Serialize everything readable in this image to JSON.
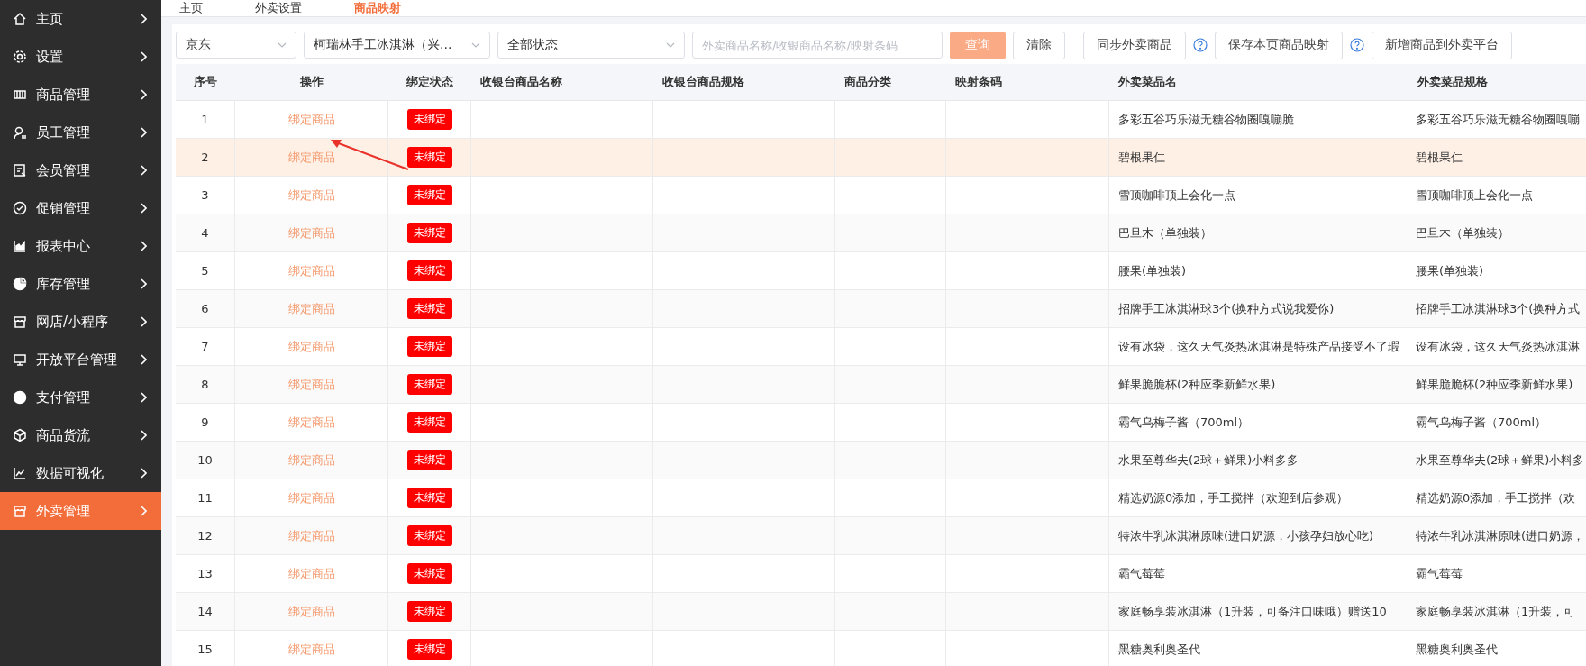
{
  "sidebar": {
    "items": [
      {
        "label": "主页",
        "selected": false
      },
      {
        "label": "设置",
        "selected": false
      },
      {
        "label": "商品管理",
        "selected": false
      },
      {
        "label": "员工管理",
        "selected": false
      },
      {
        "label": "会员管理",
        "selected": false
      },
      {
        "label": "促销管理",
        "selected": false
      },
      {
        "label": "报表中心",
        "selected": false
      },
      {
        "label": "库存管理",
        "selected": false
      },
      {
        "label": "网店/小程序",
        "selected": false
      },
      {
        "label": "开放平台管理",
        "selected": false
      },
      {
        "label": "支付管理",
        "selected": false
      },
      {
        "label": "商品货流",
        "selected": false
      },
      {
        "label": "数据可视化",
        "selected": false
      },
      {
        "label": "外卖管理",
        "selected": true
      }
    ]
  },
  "tabs": [
    {
      "label": "主页",
      "selected": false
    },
    {
      "label": "外卖设置",
      "selected": false
    },
    {
      "label": "商品映射",
      "selected": true
    }
  ],
  "toolbar": {
    "platform_select": "京东",
    "store_select": "柯瑞林手工冰淇淋（兴...",
    "status_select": "全部状态",
    "search": {
      "placeholder": "外卖商品名称/收银商品名称/映射条码"
    },
    "query_button": "查询",
    "clear_button": "清除",
    "sync_button": "同步外卖商品",
    "save_button": "保存本页商品映射",
    "add_button": "新增商品到外卖平台"
  },
  "table": {
    "columns": [
      "序号",
      "操作",
      "绑定状态",
      "收银台商品名称",
      "收银台商品规格",
      "商品分类",
      "映射条码",
      "外卖菜品名",
      "外卖菜品规格"
    ],
    "rows": [
      {
        "index": "1",
        "action": "绑定商品",
        "status": "未绑定",
        "bound": false,
        "highlighted": false,
        "dish_name": "多彩五谷巧乐滋无糖谷物圈嘎嘣脆",
        "dish_spec": "多彩五谷巧乐滋无糖谷物圈嘎嘣"
      },
      {
        "index": "2",
        "action": "绑定商品",
        "status": "未绑定",
        "bound": false,
        "highlighted": true,
        "dish_name": "碧根果仁",
        "dish_spec": "碧根果仁"
      },
      {
        "index": "3",
        "action": "绑定商品",
        "status": "未绑定",
        "bound": false,
        "highlighted": false,
        "dish_name": "雪顶咖啡顶上会化一点",
        "dish_spec": "雪顶咖啡顶上会化一点"
      },
      {
        "index": "4",
        "action": "绑定商品",
        "status": "未绑定",
        "bound": false,
        "highlighted": false,
        "dish_name": "巴旦木（单独装）",
        "dish_spec": "巴旦木（单独装）"
      },
      {
        "index": "5",
        "action": "绑定商品",
        "status": "未绑定",
        "bound": false,
        "highlighted": false,
        "dish_name": "腰果(单独装)",
        "dish_spec": "腰果(单独装)"
      },
      {
        "index": "6",
        "action": "绑定商品",
        "status": "未绑定",
        "bound": false,
        "highlighted": false,
        "dish_name": "招牌手工冰淇淋球3个(换种方式说我爱你)",
        "dish_spec": "招牌手工冰淇淋球3个(换种方式"
      },
      {
        "index": "7",
        "action": "绑定商品",
        "status": "未绑定",
        "bound": false,
        "highlighted": false,
        "dish_name": "设有冰袋，这久天气炎热冰淇淋是特殊产品接受不了瑕",
        "dish_spec": "设有冰袋，这久天气炎热冰淇淋"
      },
      {
        "index": "8",
        "action": "绑定商品",
        "status": "未绑定",
        "bound": false,
        "highlighted": false,
        "dish_name": "鲜果脆脆杯(2种应季新鲜水果)",
        "dish_spec": "鲜果脆脆杯(2种应季新鲜水果)"
      },
      {
        "index": "9",
        "action": "绑定商品",
        "status": "未绑定",
        "bound": false,
        "highlighted": false,
        "dish_name": "霸气乌梅子酱（700ml）",
        "dish_spec": "霸气乌梅子酱（700ml）"
      },
      {
        "index": "10",
        "action": "绑定商品",
        "status": "未绑定",
        "bound": false,
        "highlighted": false,
        "dish_name": "水果至尊华夫(2球＋鲜果)小料多多",
        "dish_spec": "水果至尊华夫(2球＋鲜果)小料多"
      },
      {
        "index": "11",
        "action": "绑定商品",
        "status": "未绑定",
        "bound": false,
        "highlighted": false,
        "dish_name": "精选奶源0添加，手工搅拌（欢迎到店参观）",
        "dish_spec": "精选奶源0添加，手工搅拌（欢"
      },
      {
        "index": "12",
        "action": "绑定商品",
        "status": "未绑定",
        "bound": false,
        "highlighted": false,
        "dish_name": "特浓牛乳冰淇淋原味(进口奶源，小孩孕妇放心吃)",
        "dish_spec": "特浓牛乳冰淇淋原味(进口奶源，"
      },
      {
        "index": "13",
        "action": "绑定商品",
        "status": "未绑定",
        "bound": false,
        "highlighted": false,
        "dish_name": "霸气莓莓",
        "dish_spec": "霸气莓莓"
      },
      {
        "index": "14",
        "action": "绑定商品",
        "status": "未绑定",
        "bound": false,
        "highlighted": false,
        "dish_name": "家庭畅享装冰淇淋（1升装，可备注口味哦）赠送10",
        "dish_spec": "家庭畅享装冰淇淋（1升装，可"
      },
      {
        "index": "15",
        "action": "绑定商品",
        "status": "未绑定",
        "bound": false,
        "highlighted": false,
        "dish_name": "黑糖奥利奥圣代",
        "dish_spec": "黑糖奥利奥圣代"
      }
    ]
  }
}
